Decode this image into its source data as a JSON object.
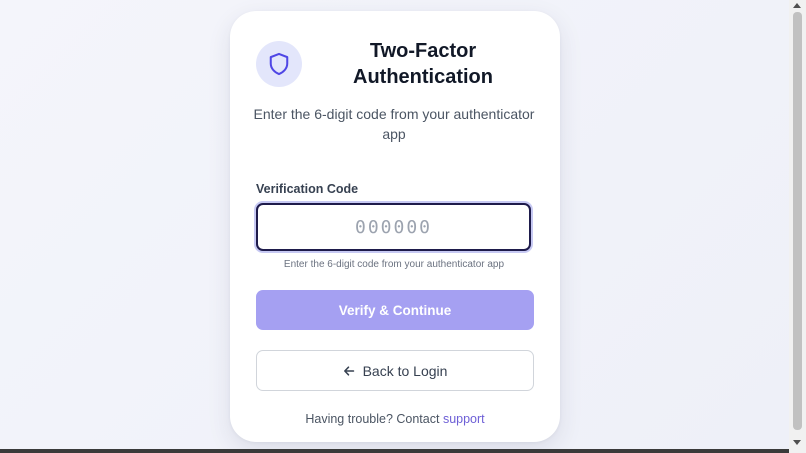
{
  "page": {
    "title": "Two-Factor Authentication",
    "subtitle": "Enter the 6-digit code from your authenticator app"
  },
  "form": {
    "code_label": "Verification Code",
    "code_placeholder": "000000",
    "code_value": "",
    "hint": "Enter the 6-digit code from your authenticator app",
    "verify_label": "Verify & Continue",
    "back_label": "Back to Login"
  },
  "footer": {
    "trouble_text": "Having trouble? Contact ",
    "support_link": "support"
  },
  "icons": {
    "header_icon": "shield-icon",
    "back_icon": "arrow-left-icon"
  },
  "colors": {
    "accent": "#a5a0f2",
    "link": "#6d5fd6",
    "icon_bg": "#e3e6fb",
    "icon_stroke": "#4f46e5"
  }
}
